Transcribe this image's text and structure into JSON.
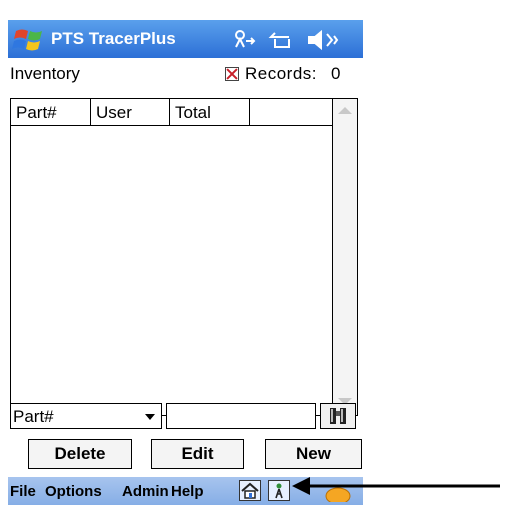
{
  "titlebar": {
    "app_title": "PTS TracerPlus",
    "icons": [
      "windows-start-icon",
      "connectivity-icon",
      "signal-icon",
      "speaker-icon"
    ]
  },
  "header": {
    "form_name": "Inventory",
    "records_label": "Records:",
    "records_count": "0"
  },
  "grid": {
    "columns": [
      "Part#",
      "User",
      "Total",
      ""
    ],
    "rows": []
  },
  "search": {
    "field_selected": "Part#",
    "query_value": "",
    "find_icon": "binoculars-icon"
  },
  "actions": {
    "delete_label": "Delete",
    "edit_label": "Edit",
    "new_label": "New"
  },
  "menubar": {
    "items": [
      "File",
      "Options",
      "Admin",
      "Help"
    ],
    "icons": [
      "home-icon",
      "tower-icon",
      "sip-keyboard-icon"
    ]
  },
  "colors": {
    "titlebar": "#2c6fd6",
    "menubar": "#86aee6",
    "records_icon_x": "#c8202a",
    "keyboard_orange": "#f5a623"
  }
}
